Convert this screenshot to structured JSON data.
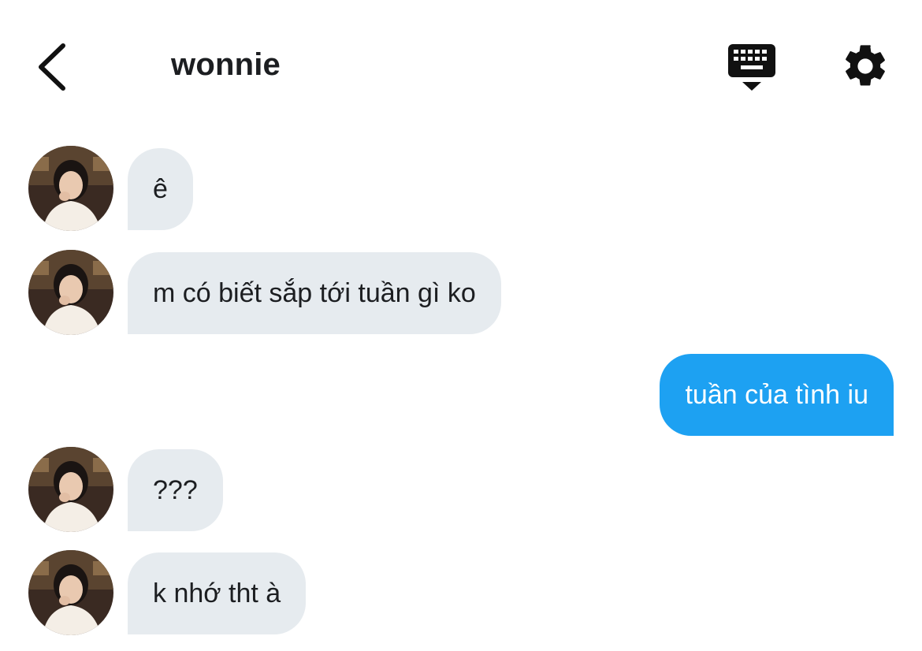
{
  "header": {
    "title": "wonnie",
    "back_icon": "chevron-left-icon",
    "keyboard_icon": "keyboard-hide-icon",
    "settings_icon": "gear-icon"
  },
  "colors": {
    "incoming_bubble": "#e6ebef",
    "outgoing_bubble": "#1da1f2",
    "text": "#1c1e21"
  },
  "messages": [
    {
      "direction": "incoming",
      "text": "ê"
    },
    {
      "direction": "incoming",
      "text": "m có biết sắp tới tuần gì ko"
    },
    {
      "direction": "outgoing",
      "text": "tuần của tình iu"
    },
    {
      "direction": "incoming",
      "text": "???"
    },
    {
      "direction": "incoming",
      "text": "k nhớ tht à"
    }
  ]
}
